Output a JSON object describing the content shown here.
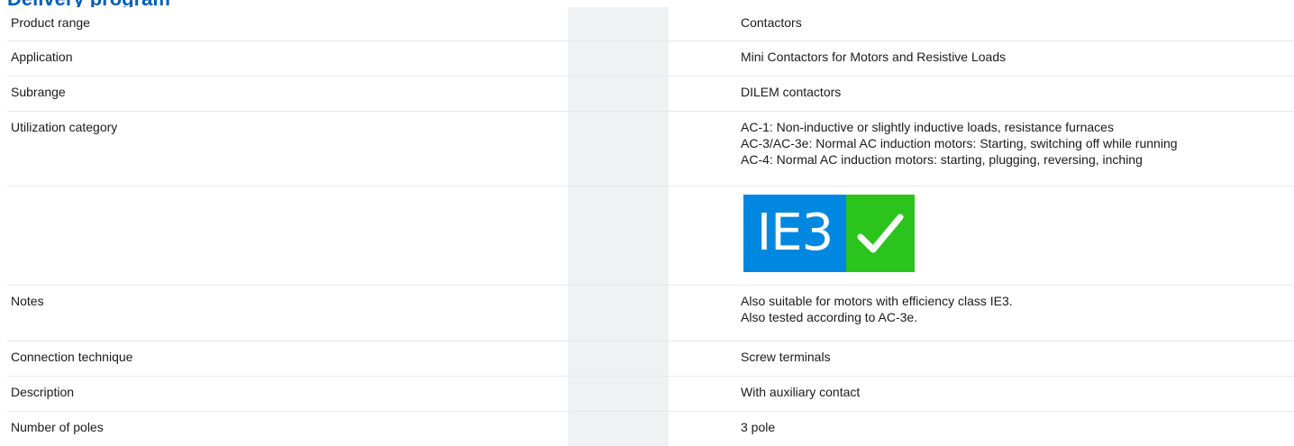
{
  "page": {
    "heading": "Delivery program"
  },
  "rows": [
    {
      "label": "Product range",
      "values": [
        "Contactors"
      ]
    },
    {
      "label": "Application",
      "values": [
        "Mini Contactors for Motors and Resistive Loads"
      ]
    },
    {
      "label": "Subrange",
      "values": [
        "DILEM contactors"
      ]
    },
    {
      "label": "Utilization category",
      "values": [
        "AC-1: Non-inductive or slightly inductive loads, resistance furnaces",
        "AC-3/AC-3e: Normal AC induction motors: Starting, switching off while running",
        "AC-4: Normal AC induction motors: starting, plugging, reversing, inching"
      ]
    },
    {
      "label": "",
      "badge": {
        "text": "IE3",
        "icon": "check-icon",
        "text_bg": "#0088e0",
        "icon_bg": "#2bc41d"
      }
    },
    {
      "label": "Notes",
      "values": [
        "Also suitable for motors with efficiency class IE3.",
        "Also tested according to AC-3e."
      ]
    },
    {
      "label": "Connection technique",
      "values": [
        "Screw terminals"
      ]
    },
    {
      "label": "Description",
      "values": [
        "With auxiliary contact"
      ]
    },
    {
      "label": "Number of poles",
      "values": [
        "3 pole"
      ]
    }
  ],
  "colors": {
    "heading": "#005eb8",
    "shade_column": "#f0f1f3",
    "row_divider": "#e8e8e8"
  }
}
